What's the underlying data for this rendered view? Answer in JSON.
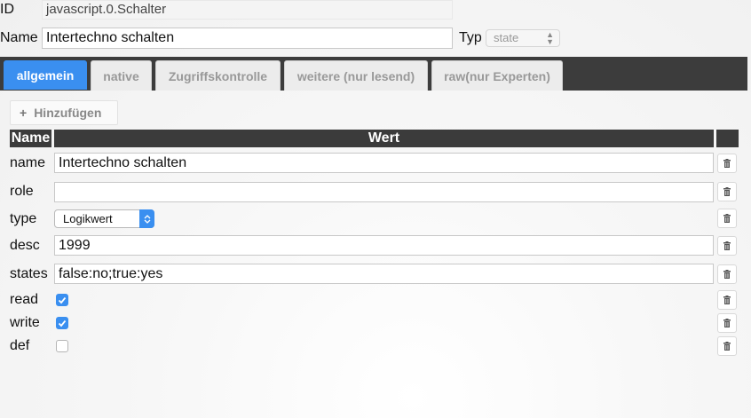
{
  "header": {
    "id_label": "ID",
    "id_value": "javascript.0.Schalter",
    "name_label": "Name",
    "name_value": "Intertechno schalten",
    "type_label": "Typ",
    "type_value": "state"
  },
  "tabs": [
    {
      "label": "allgemein",
      "active": true
    },
    {
      "label": "native",
      "active": false
    },
    {
      "label": "Zugriffskontrolle",
      "active": false
    },
    {
      "label": "weitere (nur lesend)",
      "active": false
    },
    {
      "label": "raw(nur Experten)",
      "active": false
    }
  ],
  "toolbar": {
    "add_label": "Hinzufügen",
    "add_icon": "plus-icon"
  },
  "table": {
    "columns": [
      "Name",
      "Wert"
    ],
    "rows": [
      {
        "name": "name",
        "kind": "text",
        "value": "Intertechno schalten"
      },
      {
        "name": "role",
        "kind": "text",
        "value": ""
      },
      {
        "name": "type",
        "kind": "select",
        "value": "Logikwert"
      },
      {
        "name": "desc",
        "kind": "text",
        "value": "1999"
      },
      {
        "name": "states",
        "kind": "text",
        "value": "false:no;true:yes"
      },
      {
        "name": "read",
        "kind": "checkbox",
        "checked": true
      },
      {
        "name": "write",
        "kind": "checkbox",
        "checked": true
      },
      {
        "name": "def",
        "kind": "checkbox",
        "checked": false
      }
    ],
    "delete_icon": "trash-icon"
  },
  "colors": {
    "accent": "#3a8ff0",
    "tabbar": "#3c3c3c",
    "table_header": "#3b3b3b"
  }
}
